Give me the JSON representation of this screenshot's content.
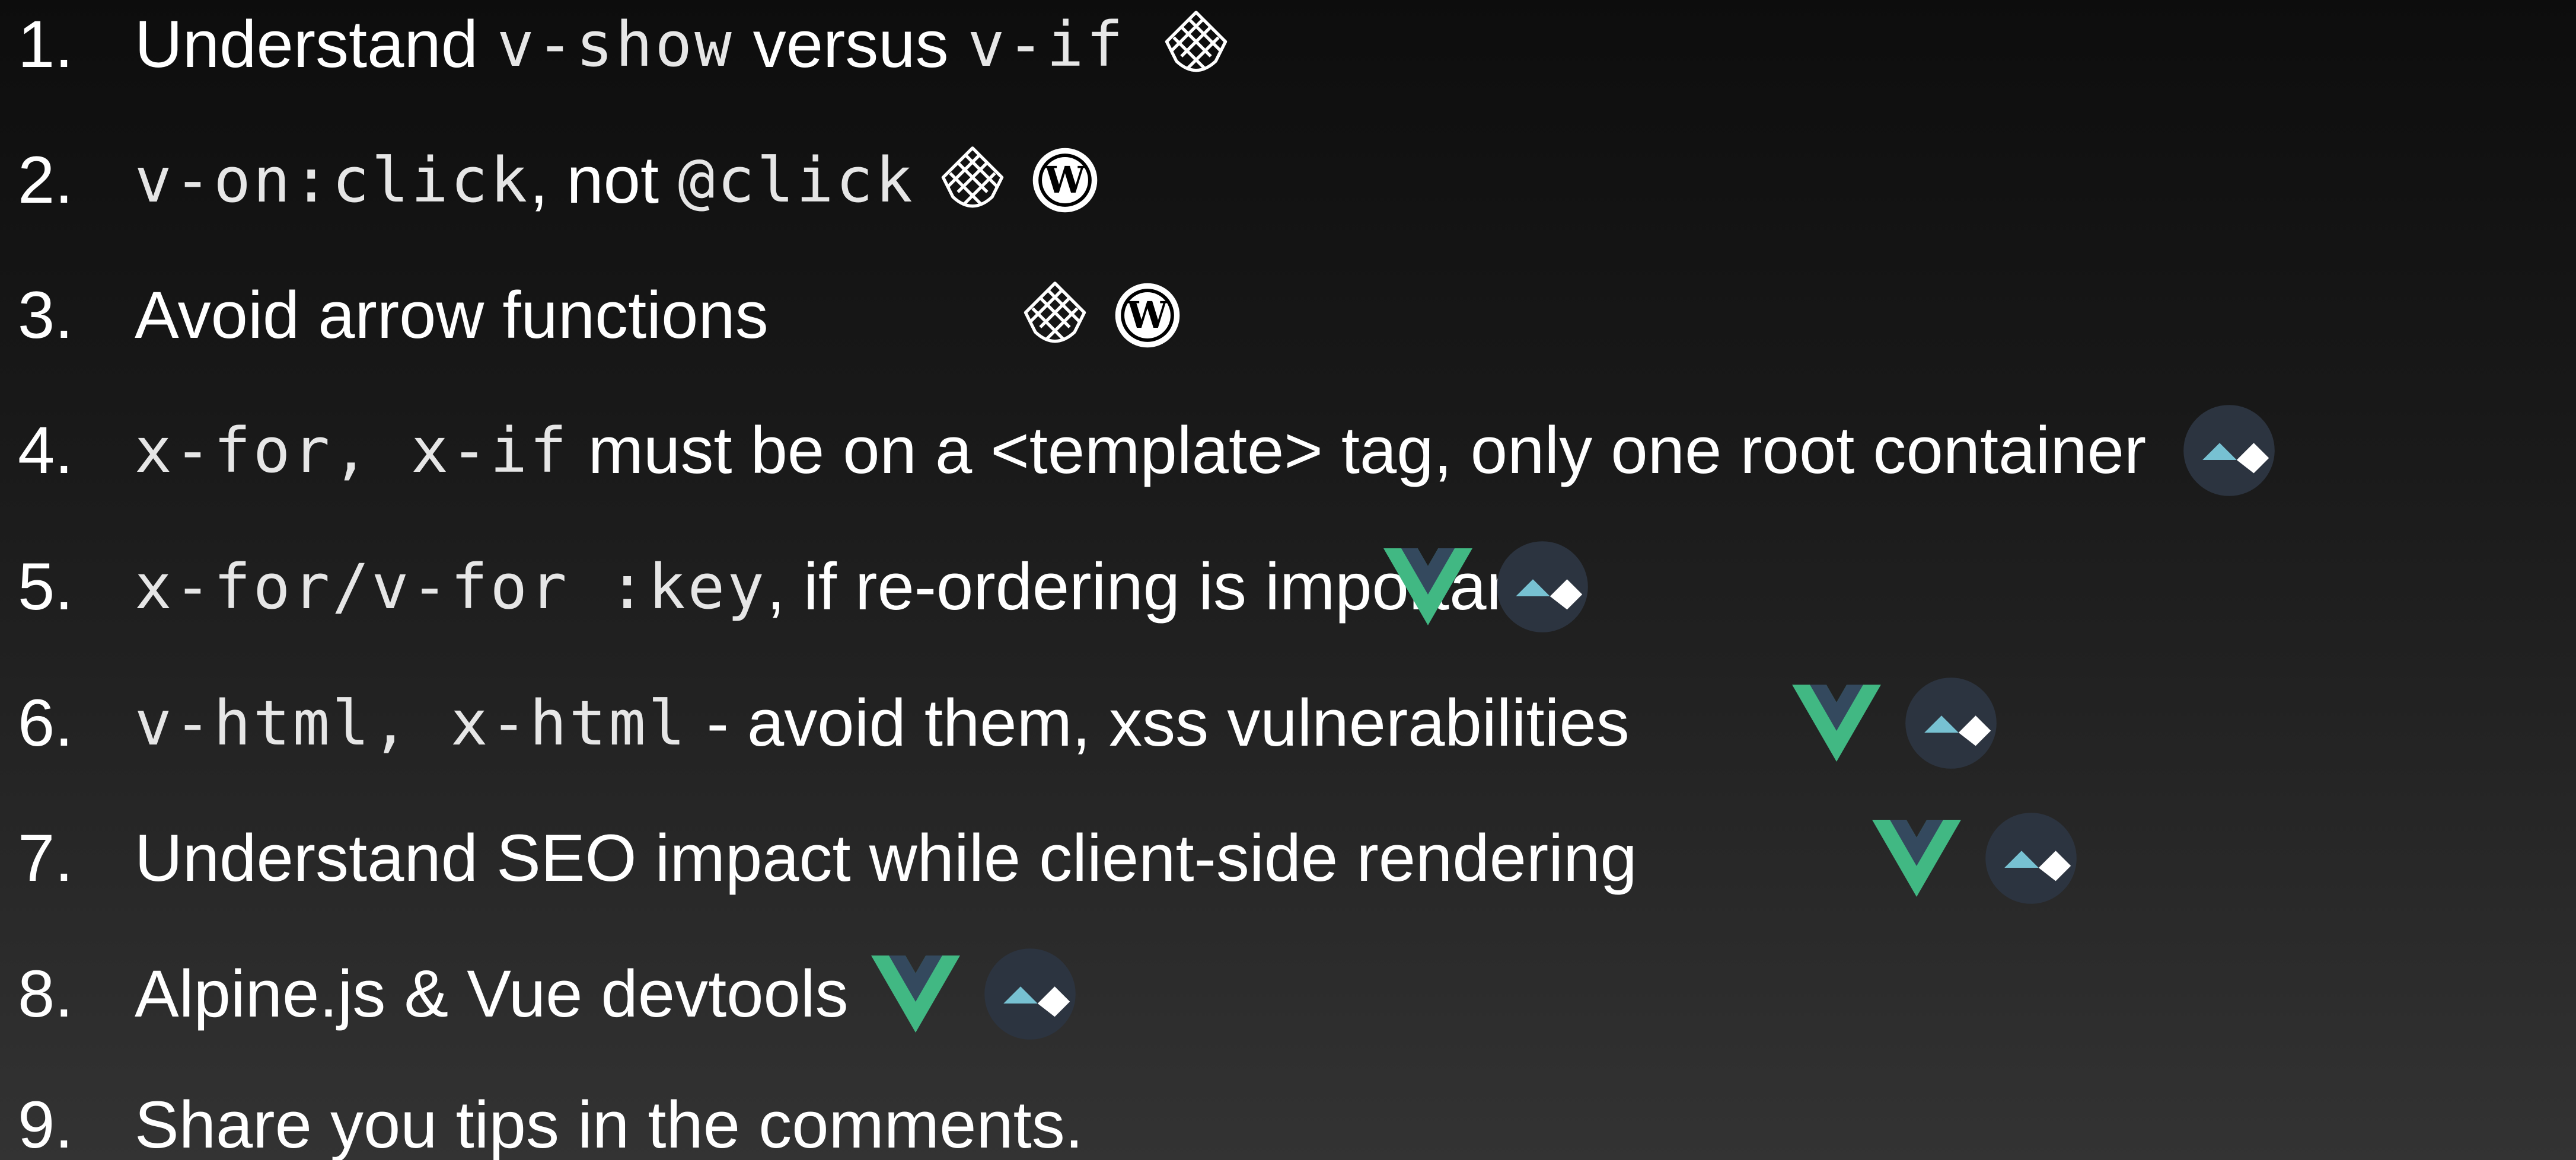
{
  "colors": {
    "background_top": "#0d0d0d",
    "background_bottom": "#333333",
    "text": "#ffffff",
    "vue_green": "#41b883",
    "vue_dark": "#34495e",
    "alpine_circle": "#2c3440",
    "alpine_light": "#77c1d2"
  },
  "items": [
    {
      "number": "1.",
      "parts": [
        {
          "text": "Understand"
        },
        {
          "code": "v-show"
        },
        {
          "text": "versus"
        },
        {
          "code": "v-if"
        }
      ],
      "icons": [
        "pinecone-icon"
      ]
    },
    {
      "number": "2.",
      "parts": [
        {
          "code": "v-on:click"
        },
        {
          "text": ", not"
        },
        {
          "code": "@click"
        }
      ],
      "icons": [
        "pinecone-icon",
        "wordpress-icon"
      ]
    },
    {
      "number": "3.",
      "parts": [
        {
          "text": "Avoid arrow functions"
        }
      ],
      "icons": [
        "pinecone-icon",
        "wordpress-icon"
      ]
    },
    {
      "number": "4.",
      "parts": [
        {
          "code": "x-for, x-if"
        },
        {
          "text": "must be on a <template> tag, only one root container"
        }
      ],
      "icons": [
        "alpine-icon"
      ]
    },
    {
      "number": "5.",
      "parts": [
        {
          "code": "x-for/v-for :key"
        },
        {
          "text": ", if re-ordering is important"
        }
      ],
      "icons": [
        "vue-icon",
        "alpine-icon"
      ]
    },
    {
      "number": "6.",
      "parts": [
        {
          "code": "v-html, x-html"
        },
        {
          "text": "- avoid them, xss vulnerabilities"
        }
      ],
      "icons": [
        "vue-icon",
        "alpine-icon"
      ]
    },
    {
      "number": "7.",
      "parts": [
        {
          "text": "Understand SEO impact while client-side rendering"
        }
      ],
      "icons": [
        "vue-icon",
        "alpine-icon"
      ]
    },
    {
      "number": "8.",
      "parts": [
        {
          "text": "Alpine.js & Vue devtools"
        }
      ],
      "icons": [
        "vue-icon",
        "alpine-icon"
      ]
    },
    {
      "number": "9.",
      "parts": [
        {
          "text": "Share you tips in the comments."
        }
      ],
      "icons": []
    }
  ]
}
